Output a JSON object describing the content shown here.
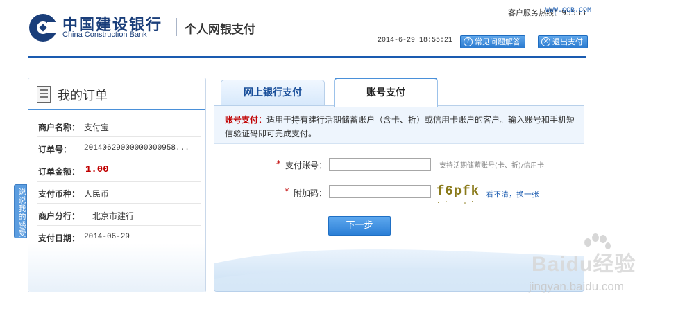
{
  "header": {
    "bank_name_cn": "中国建设银行",
    "bank_name_en": "China Construction Bank",
    "service_title": "个人网银支付",
    "hotline": "客户服务热线：95533",
    "hotline_separator": "|",
    "site_link": "WWW.CCB.COM",
    "datetime": "2014-6-29 18:55:21",
    "faq_button": "常见问题解答",
    "exit_button": "退出支付",
    "faq_icon_glyph": "?",
    "exit_icon_glyph": "×"
  },
  "order": {
    "title": "我的订单",
    "rows": [
      {
        "label": "商户名称：",
        "value": "支付宝"
      },
      {
        "label": "订单号：",
        "value": "20140629000000000958..."
      },
      {
        "label": "订单金额：",
        "value": "1.00"
      },
      {
        "label": "支付币种：",
        "value": "人民币"
      },
      {
        "label": "商户分行：",
        "value": "北京市建行"
      },
      {
        "label": "支付日期：",
        "value": "2014-06-29"
      }
    ]
  },
  "side_tab": {
    "label": "说说我的感受"
  },
  "tabs": [
    {
      "label": "网上银行支付",
      "active": false
    },
    {
      "label": "账号支付",
      "active": true
    }
  ],
  "account_pay": {
    "notice_label": "账号支付：",
    "notice_text": "适用于持有建行活期储蓄账户（含卡、折）或信用卡账户的客户。输入账号和手机短信验证码即可完成支付。",
    "required_mark": "*",
    "account_label": "支付账号：",
    "account_value": "",
    "account_hint": "支持活期储蓄账号(卡、折)/信用卡",
    "captcha_label": "附加码：",
    "captcha_value": "",
    "captcha_text": "f6pfk",
    "captcha_refresh": "看不清，换一张",
    "next_button": "下一步"
  },
  "watermark": {
    "brand": "Baidu经验",
    "url": "jingyan.baidu.com"
  },
  "colors": {
    "brand_blue": "#1a5bb0",
    "required_red": "#c00000",
    "panel_border": "#b8d0ea"
  }
}
